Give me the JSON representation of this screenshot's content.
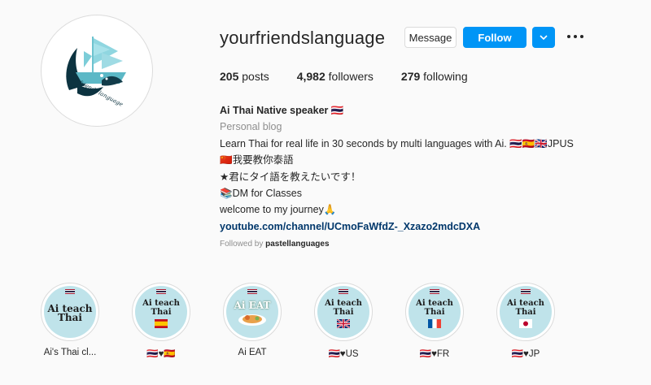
{
  "profile": {
    "username": "yourfriendslanguage",
    "avatar_text": "Your friends language",
    "buttons": {
      "message": "Message",
      "follow": "Follow"
    },
    "stats": {
      "posts_count": "205",
      "posts_label": "posts",
      "followers_count": "4,982",
      "followers_label": "followers",
      "following_count": "279",
      "following_label": "following"
    },
    "bio": {
      "name": "Ai Thai Native speaker 🇹🇭",
      "category": "Personal blog",
      "line1": "Learn Thai for real life in 30 seconds by multi languages with Ai. 🇹🇭🇪🇸🇬🇧JPUS",
      "line2": "🇨🇳我要教你泰語",
      "line3": "★君にタイ語を教えたいです！",
      "line4": "📚DM for Classes",
      "line5": "welcome to my journey🙏",
      "link": "youtube.com/channel/UCmoFaWfdZ-_Xzazo2mdcDXA",
      "followed_by_prefix": "Followed by ",
      "followed_by_user": "pastellanguages"
    },
    "colors": {
      "accent": "#0095f6",
      "link": "#00376b",
      "muted": "#8e8e8e"
    }
  },
  "highlights": [
    {
      "title": "Ai teach Thai",
      "label": "Ai's Thai cl...",
      "flag": "none"
    },
    {
      "title": "Ai teach Thai",
      "label": "🇹🇭♥🇪🇸",
      "flag": "spain"
    },
    {
      "title": "Ai EAT",
      "label": "Ai EAT",
      "flag": "food"
    },
    {
      "title": "Ai teach Thai",
      "label": "🇹🇭♥US",
      "flag": "uk"
    },
    {
      "title": "Ai teach Thai",
      "label": "🇹🇭♥FR",
      "flag": "france"
    },
    {
      "title": "Ai teach Thai",
      "label": "🇹🇭♥JP",
      "flag": "japan"
    }
  ]
}
